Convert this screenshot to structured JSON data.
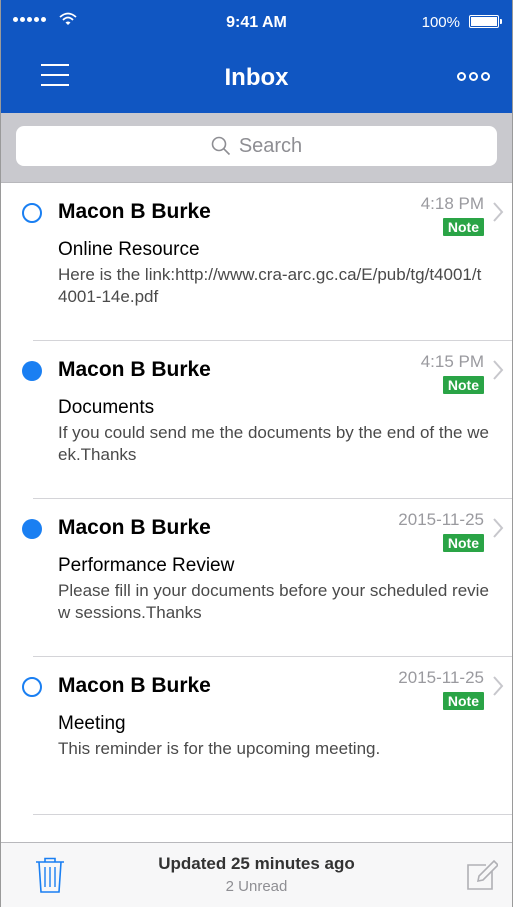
{
  "status_bar": {
    "time": "9:41 AM",
    "battery": "100%"
  },
  "nav": {
    "title": "Inbox",
    "left_icon": "hamburger-menu-icon",
    "right_icon": "more-options-icon"
  },
  "search": {
    "placeholder": "Search"
  },
  "messages": [
    {
      "sender": "Macon B Burke",
      "date": "4:18 PM",
      "tag": "Note",
      "subject": "Online Resource",
      "preview": "Here is the link:http://www.cra-arc.gc.ca/E/pub/tg/t4001/t4001-14e.pdf",
      "unread": false
    },
    {
      "sender": "Macon B Burke",
      "date": "4:15 PM",
      "tag": "Note",
      "subject": "Documents",
      "preview": "If you could send me the documents by the end of the week.Thanks",
      "unread": true
    },
    {
      "sender": "Macon B Burke",
      "date": "2015-11-25",
      "tag": "Note",
      "subject": "Performance Review",
      "preview": "Please fill in your documents before your scheduled review sessions.Thanks",
      "unread": true
    },
    {
      "sender": "Macon B Burke",
      "date": "2015-11-25",
      "tag": "Note",
      "subject": "Meeting",
      "preview": "This reminder is for the upcoming meeting.",
      "unread": false
    }
  ],
  "toolbar": {
    "updated": "Updated 25 minutes ago",
    "unread_count": "2 Unread",
    "left_icon": "trash-icon",
    "right_icon": "compose-icon"
  },
  "colors": {
    "header": "#1056c2",
    "unread_dot": "#1a7ff2",
    "note_badge": "#2aa446"
  }
}
